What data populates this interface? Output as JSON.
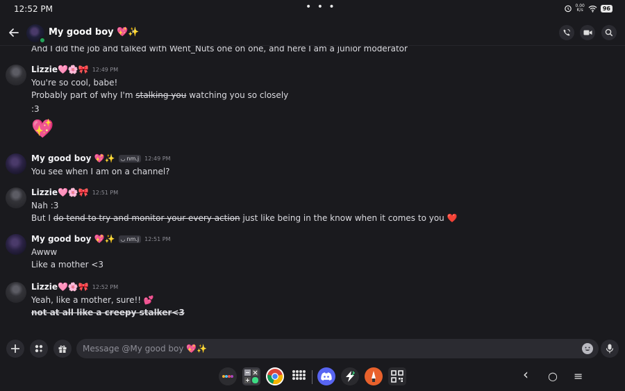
{
  "status_bar": {
    "time": "12:52 PM",
    "dots": "• • •",
    "net_speed_top": "0.00",
    "net_speed_bottom": "K/s",
    "battery": "96"
  },
  "header": {
    "title": "My good boy 💖✨",
    "chevron": "›"
  },
  "messages": [
    {
      "type": "continuation",
      "text": "And I did the job and talked with Went_Nuts one on one, and here I am a junior moderator"
    },
    {
      "author": "Lizzie🩷🌸🎀",
      "timestamp": "12:49 PM",
      "lines": [
        {
          "text": "You're so cool, babe!"
        },
        {
          "before": "Probably part of why I'm ",
          "struck": "stalking you",
          "after": " watching you so closely"
        },
        {
          "text": ":3"
        }
      ],
      "big_emoji": "💖"
    },
    {
      "author": "My good boy 💖✨",
      "tag": "nm.j",
      "timestamp": "12:49 PM",
      "lines": [
        {
          "text": "You see when I am on a channel?"
        }
      ]
    },
    {
      "author": "Lizzie🩷🌸🎀",
      "timestamp": "12:51 PM",
      "lines": [
        {
          "text": "Nah :3"
        },
        {
          "before": "But I ",
          "struck": "do tend to try and monitor your every action",
          "after": " just like being in the know when it comes to you ",
          "emoji": "❤️"
        }
      ]
    },
    {
      "author": "My good boy 💖✨",
      "tag": "nm.j",
      "timestamp": "12:51 PM",
      "lines": [
        {
          "text": "Awww"
        },
        {
          "text": "Like a mother <3"
        }
      ]
    },
    {
      "author": "Lizzie🩷🌸🎀",
      "timestamp": "12:52 PM",
      "lines": [
        {
          "text": "Yeah, like a mother, sure!! ",
          "emoji": "💕"
        },
        {
          "struck_bold": "not at all like a creepy stalker<3"
        }
      ]
    }
  ],
  "composer": {
    "placeholder": "Message @My good boy 💖✨"
  },
  "icons": {
    "back": "arrow-left-icon",
    "call": "phone-call-icon",
    "video": "video-camera-icon",
    "search": "search-icon",
    "add": "plus-icon",
    "apps": "apps-icon",
    "gift": "gift-icon",
    "emoji": "emoji-icon",
    "mic": "microphone-icon"
  },
  "taskbar": {
    "apps": [
      "app-folder",
      "calculator",
      "chrome",
      "app-grid",
      "discord",
      "bolt-app",
      "art-app",
      "qr-scanner"
    ],
    "nav": {
      "back": "‹",
      "home": "○",
      "menu": "≡"
    }
  },
  "colors": {
    "background": "#1a1a1e",
    "surface": "#2b2b31",
    "online": "#23a55a",
    "discord": "#5865f2",
    "heart": "#e0384e"
  }
}
